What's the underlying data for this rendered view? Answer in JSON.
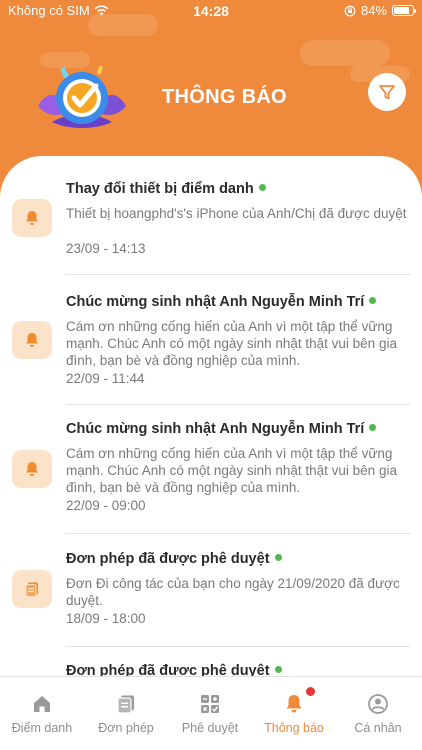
{
  "status_bar": {
    "carrier": "Không có SIM",
    "time": "14:28",
    "battery": "84%",
    "battery_level": 0.84,
    "icons": [
      "wifi-icon",
      "orientation-lock-icon",
      "battery-icon"
    ]
  },
  "header": {
    "title": "THÔNG BÁO",
    "logo_icon": "check-badge-logo",
    "filter_icon": "filter-icon"
  },
  "colors": {
    "accent": "#ef8a3c",
    "unread_dot": "#4cbb4a",
    "icon_bg": "#fbe3c9",
    "badge": "#e53935"
  },
  "notifications": [
    {
      "title": "Thay đổi thiết bị điểm danh",
      "body": "Thiết bị hoangphd's's iPhone của Anh/Chị đã được duyệt",
      "time": "23/09 - 14:13",
      "icon": "bell-icon",
      "unread": true
    },
    {
      "title": "Chúc mừng sinh nhật Anh Nguyễn Minh Trí",
      "body": "Cám ơn những cống hiến của Anh vì một tập thể vững mạnh. Chúc Anh có một ngày sinh nhật thật vui bên gia đình, bạn bè và đồng nghiệp của mình.",
      "time": "22/09 - 11:44",
      "icon": "bell-icon",
      "unread": true
    },
    {
      "title": "Chúc mừng sinh nhật Anh Nguyễn Minh Trí",
      "body": "Cám ơn những cống hiến của Anh vì một tập thể vững mạnh. Chúc Anh có một ngày sinh nhật thật vui bên gia đình, bạn bè và đồng nghiệp của mình.",
      "time": "22/09 - 09:00",
      "icon": "bell-icon",
      "unread": true
    },
    {
      "title": "Đơn phép đã được phê duyệt",
      "body": "Đơn Đi công tác của bạn cho ngày 21/09/2020 đã được duyệt.",
      "time": "18/09 - 18:00",
      "icon": "document-icon",
      "unread": true
    },
    {
      "title": "Đơn phép đã được phê duyệt",
      "body": "",
      "time": "",
      "icon": "document-icon",
      "unread": true
    }
  ],
  "bottom_nav": [
    {
      "label": "Điểm danh",
      "icon": "home-icon",
      "active": false
    },
    {
      "label": "Đơn phép",
      "icon": "leave-form-icon",
      "active": false
    },
    {
      "label": "Phê duyệt",
      "icon": "approval-grid-icon",
      "active": false
    },
    {
      "label": "Thông báo",
      "icon": "bell-icon",
      "active": true,
      "has_badge": true
    },
    {
      "label": "Cá nhân",
      "icon": "profile-icon",
      "active": false
    }
  ]
}
